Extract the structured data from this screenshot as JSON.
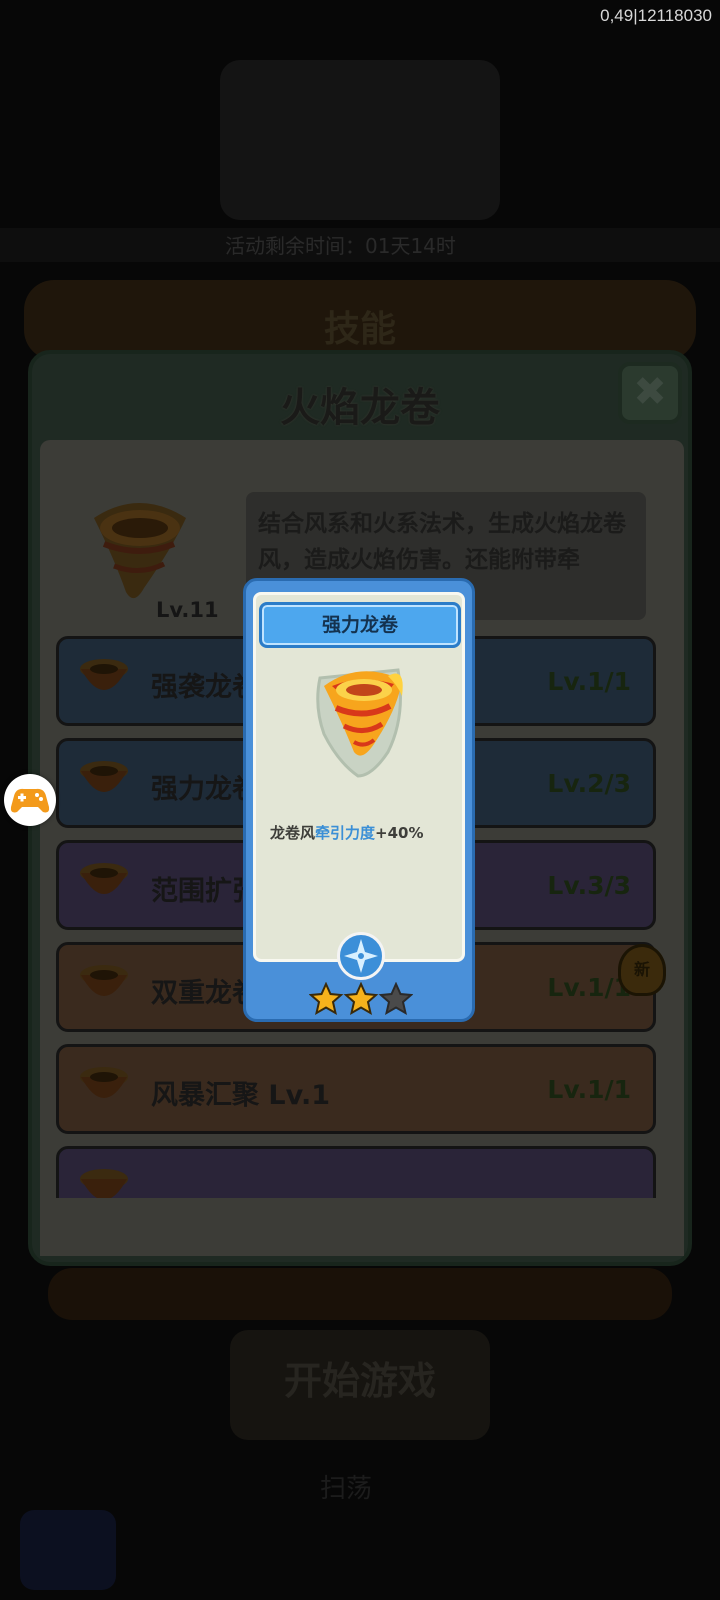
{
  "debug_text": "0,49|12118030",
  "background": {
    "banner_text": "",
    "timer_text": "活动剩余时间：01天14时",
    "ribbon_title": "技能",
    "start_button": "开始游戏",
    "sub_text": "扫荡"
  },
  "panel": {
    "title": "火焰龙卷",
    "close_icon": "close-icon",
    "description": "结合风系和火系法术，生成火焰龙卷风，造成火焰伤害。还能附带牵",
    "skill_level": "Lv.11",
    "rows": [
      {
        "name": "强袭龙卷",
        "level": "Lv.1/1",
        "color": "blue"
      },
      {
        "name": "强力龙卷",
        "level": "Lv.2/3",
        "color": "blue"
      },
      {
        "name": "范围扩张",
        "level": "Lv.3/3",
        "color": "purple"
      },
      {
        "name": "双重龙卷",
        "level": "Lv.1/1",
        "color": "brown"
      },
      {
        "name": "风暴汇聚 Lv.1",
        "level": "Lv.1/1",
        "color": "brown"
      },
      {
        "name": "",
        "level": "",
        "color": "purple"
      }
    ],
    "new_badge": "新"
  },
  "popup": {
    "title": "强力龙卷",
    "desc_prefix": "龙卷风",
    "desc_highlight": "牵引力度",
    "desc_suffix": "+40%",
    "stars_filled": 2,
    "stars_total": 3
  },
  "colors": {
    "card_blue": "#4a90d9",
    "highlight": "#3b8fd6",
    "star_gold": "#f6b21c"
  }
}
